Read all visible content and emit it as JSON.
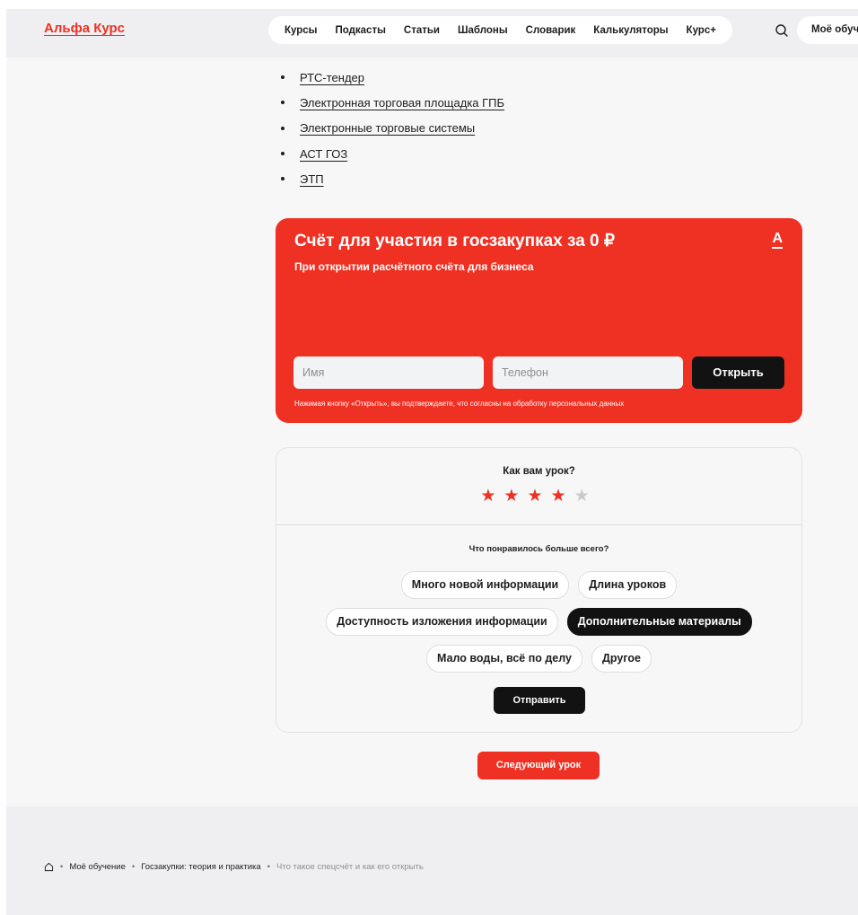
{
  "header": {
    "logo": "Альфа Курс",
    "nav": [
      "Курсы",
      "Подкасты",
      "Статьи",
      "Шаблоны",
      "Словарик",
      "Калькуляторы",
      "Курс+"
    ],
    "my_learning": "Моё обучение"
  },
  "list": [
    "РТС-тендер",
    "Электронная торговая площадка ГПБ",
    "Электронные торговые системы",
    "АСТ ГОЗ",
    "ЭТП"
  ],
  "promo": {
    "title": "Счёт для участия в госзакупках за 0 ₽",
    "subtitle": "При открытии расчётного счёта для бизнеса",
    "logo": "A",
    "name_placeholder": "Имя",
    "phone_placeholder": "Телефон",
    "open_button": "Открыть",
    "note": "Нажимая кнопку «Открыть», вы подтверждаете, что согласны на обработку персональных данных"
  },
  "rating": {
    "question": "Как вам урок?",
    "stars_filled": 4,
    "stars_total": 5,
    "liked_question": "Что понравилось больше всего?",
    "chips_row1": [
      "Много новой информации",
      "Длина уроков"
    ],
    "chips_row2": [
      "Доступность изложения информации",
      "Дополнительные материалы"
    ],
    "chips_row3": [
      "Мало воды, всё по делу",
      "Другое"
    ],
    "selected_chip": "Дополнительные материалы",
    "send_button": "Отправить"
  },
  "next_button": "Следующий урок",
  "breadcrumbs": [
    "Моё обучение",
    "Госзакупки: теория и практика",
    "Что такое спецсчёт и как его открыть"
  ],
  "colors": {
    "accent": "#ef3124",
    "dark": "#121213"
  }
}
